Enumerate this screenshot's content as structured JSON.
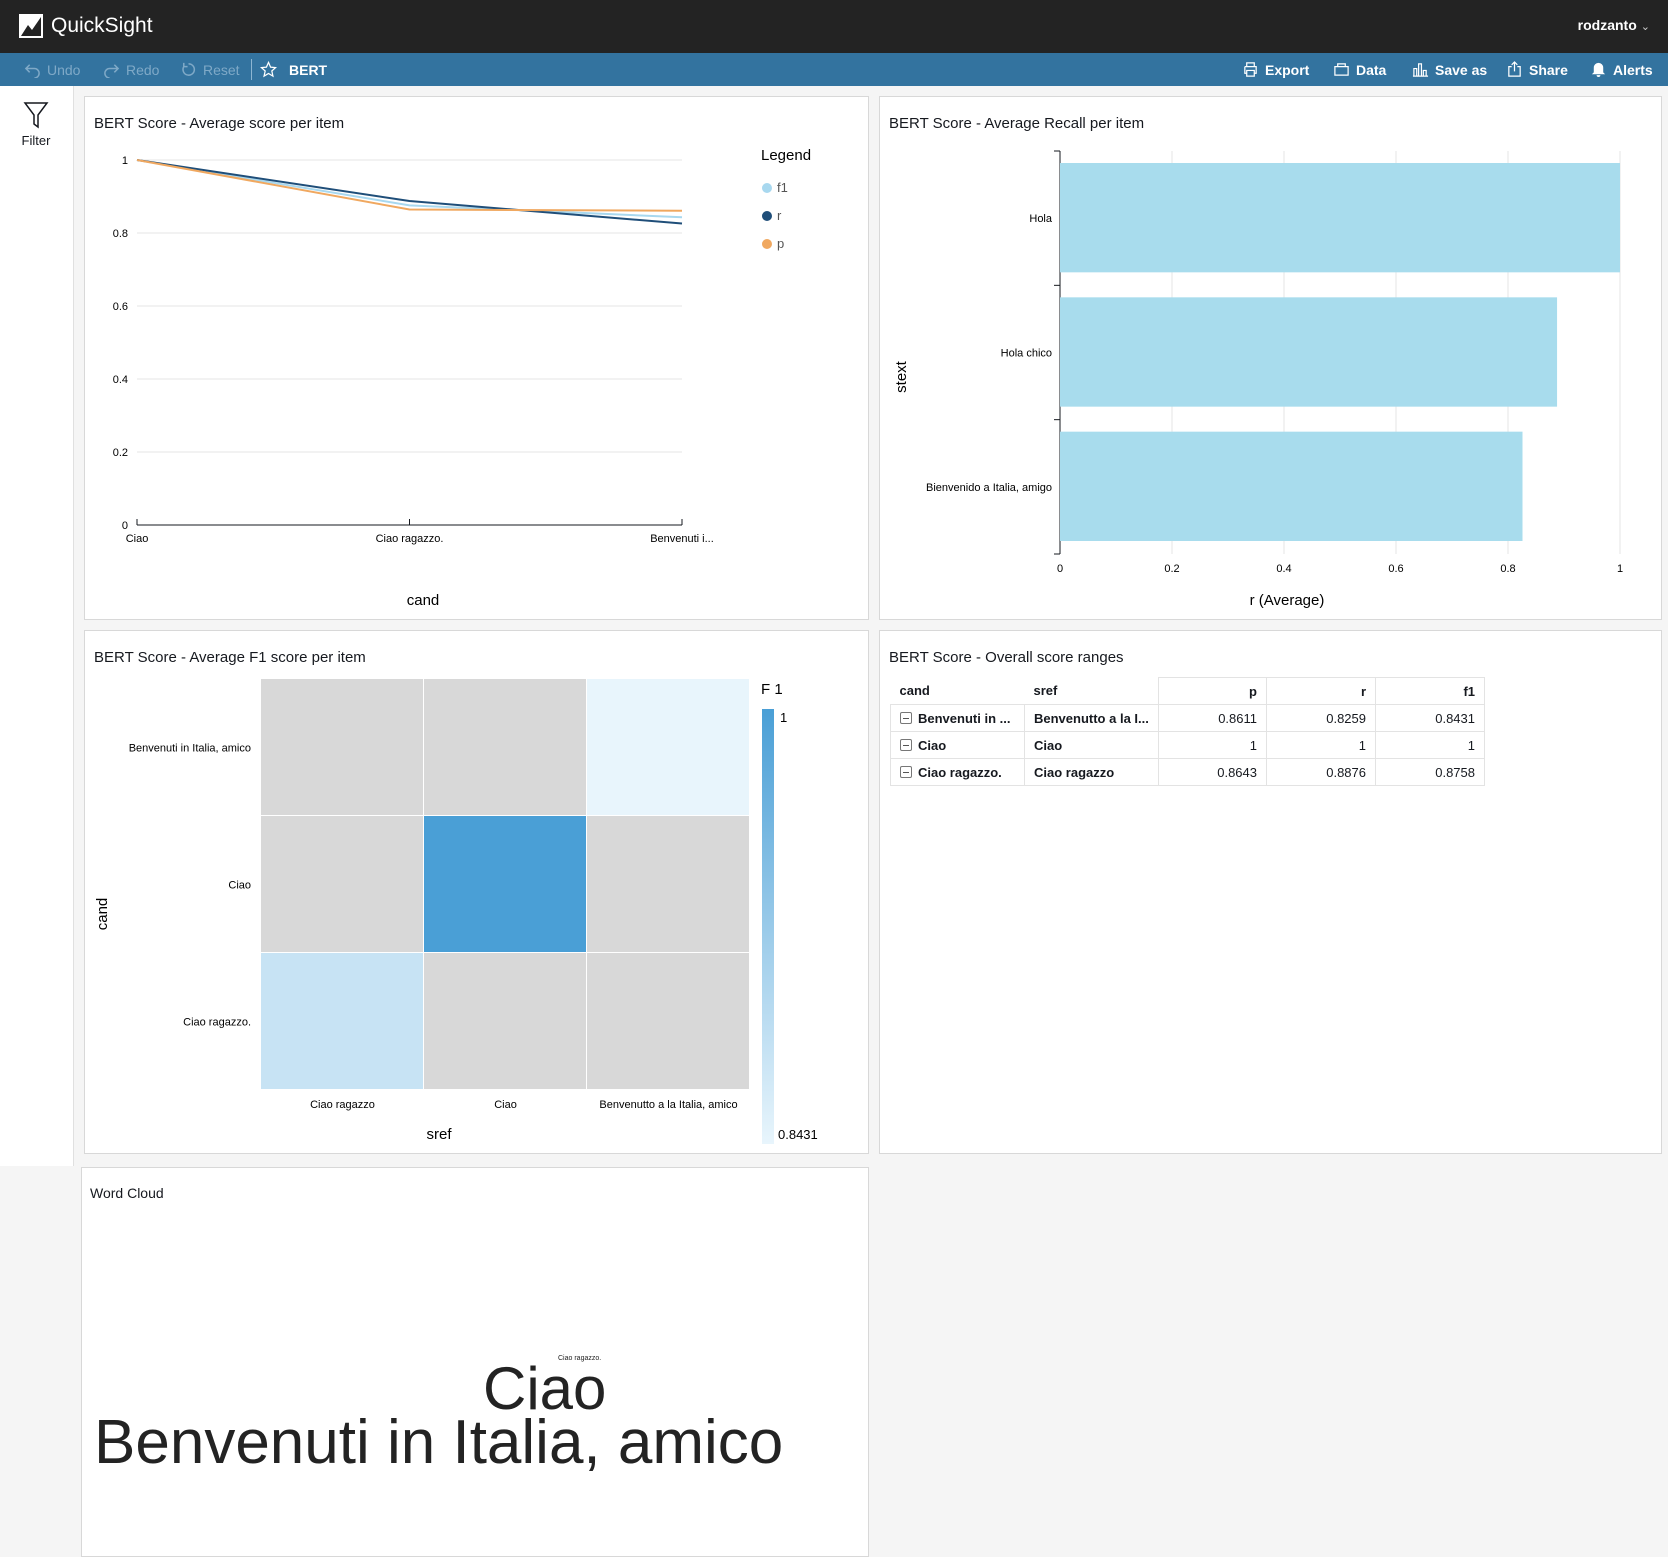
{
  "header": {
    "app_name": "QuickSight",
    "user": "rodzanto"
  },
  "toolbar": {
    "undo": "Undo",
    "redo": "Redo",
    "reset": "Reset",
    "analysis_name": "BERT",
    "export": "Export",
    "data": "Data",
    "save_as": "Save as",
    "share": "Share",
    "alerts": "Alerts"
  },
  "sidebar": {
    "filter": "Filter"
  },
  "colors": {
    "topbar": "#232323",
    "toolbar": "#33739f",
    "f1": "#a8d8ef",
    "r": "#1f4e79",
    "p": "#f0a860",
    "bar": "#a8dced",
    "heat_max": "#4a9fd6",
    "heat_null": "#d8d8d8"
  },
  "line_panel": {
    "title": "BERT Score - Average score per item",
    "chart_data": {
      "type": "line",
      "categories": [
        "Ciao",
        "Ciao ragazzo.",
        "Benvenuti i..."
      ],
      "series": [
        {
          "name": "f1",
          "values": [
            1,
            0.8758,
            0.8431
          ]
        },
        {
          "name": "r",
          "values": [
            1,
            0.8876,
            0.8259
          ]
        },
        {
          "name": "p",
          "values": [
            1,
            0.8643,
            0.8611
          ]
        }
      ],
      "legend_title": "Legend",
      "xlabel": "cand",
      "ylabel": "",
      "ylim": [
        0,
        1
      ],
      "yticks": [
        "0",
        "0.2",
        "0.4",
        "0.6",
        "0.8",
        "1"
      ],
      "grid": true,
      "legend_position": "right"
    }
  },
  "bar_panel": {
    "title": "BERT Score - Average Recall per item",
    "chart_data": {
      "type": "bar",
      "orientation": "horizontal",
      "categories": [
        "Hola",
        "Hola chico",
        "Bienvenido a Italia, amigo"
      ],
      "values": [
        1,
        0.8876,
        0.8259
      ],
      "xlabel": "r (Average)",
      "ylabel": "stext",
      "xlim": [
        0,
        1
      ],
      "xticks": [
        "0",
        "0.2",
        "0.4",
        "0.6",
        "0.8",
        "1"
      ],
      "grid": true
    }
  },
  "heatmap_panel": {
    "title": "BERT Score - Average F1 score per item",
    "chart_data": {
      "type": "heatmap",
      "rows": [
        "Benvenuti in Italia, amico",
        "Ciao",
        "Ciao ragazzo."
      ],
      "columns": [
        "Ciao ragazzo",
        "Ciao",
        "Benvenutto a la Italia, amico"
      ],
      "values": [
        [
          null,
          null,
          0.8431
        ],
        [
          null,
          1,
          null
        ],
        [
          0.8758,
          null,
          null
        ]
      ],
      "xlabel": "sref",
      "ylabel": "cand",
      "legend_title": "F 1",
      "legend_max": "1",
      "legend_min": "0.8431"
    }
  },
  "table_panel": {
    "title": "BERT Score - Overall score ranges",
    "columns": [
      "cand",
      "sref",
      "p",
      "r",
      "f1"
    ],
    "rows": [
      [
        "Benvenuti in ...",
        "Benvenutto a la I...",
        "0.8611",
        "0.8259",
        "0.8431"
      ],
      [
        "Ciao",
        "Ciao",
        "1",
        "1",
        "1"
      ],
      [
        "Ciao ragazzo.",
        "Ciao ragazzo",
        "0.8643",
        "0.8876",
        "0.8758"
      ]
    ]
  },
  "wordcloud_panel": {
    "title": "Word Cloud",
    "words": [
      "Ciao ragazzo.",
      "Ciao",
      "Benvenuti in Italia, amico"
    ]
  }
}
